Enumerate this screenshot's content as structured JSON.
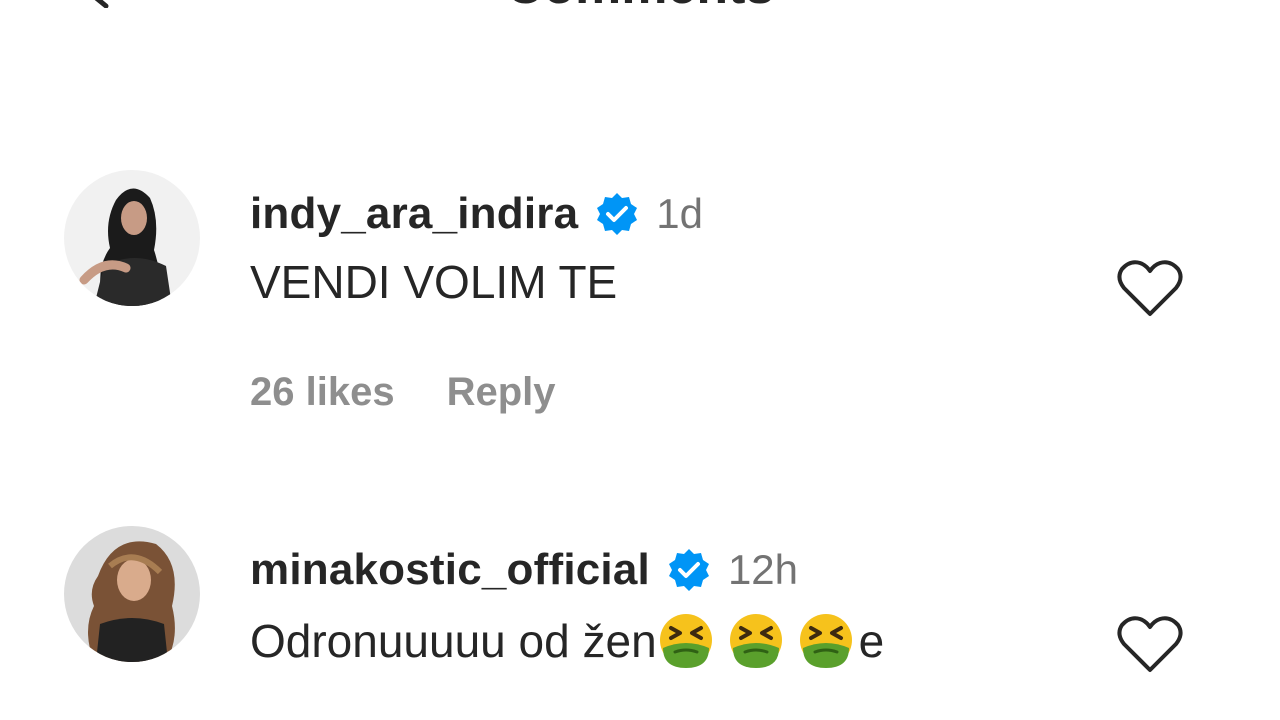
{
  "header": {
    "title": "Comments",
    "back_icon": "back-arrow-icon"
  },
  "comments": [
    {
      "username": "indy_ara_indira",
      "verified_icon": "verified-badge-icon",
      "time": "1d",
      "text": "VENDI VOLIM TE",
      "likes": "26 likes",
      "reply_label": "Reply",
      "like_icon": "heart-outline-icon"
    },
    {
      "username": "minakostic_official",
      "verified_icon": "verified-badge-icon",
      "time": "12h",
      "text_prefix": "Odronuuuuu od žen",
      "text_suffix": "e",
      "emoji_icon": "nauseated-face-emoji",
      "emoji_count": 3,
      "like_icon": "heart-outline-icon"
    }
  ],
  "colors": {
    "text_primary": "#262626",
    "text_secondary": "#737373",
    "actions": "#8e8e8e",
    "verified_blue": "#0095f6"
  }
}
